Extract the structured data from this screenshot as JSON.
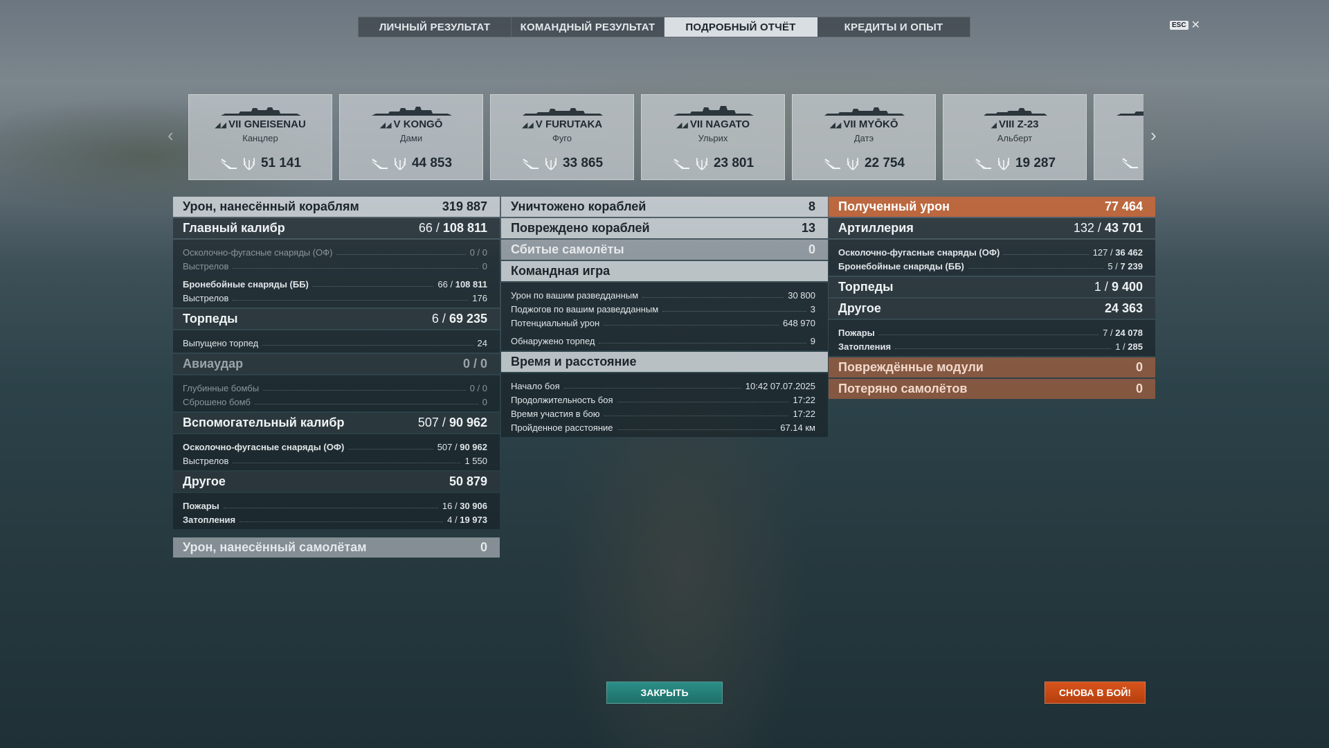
{
  "tabs": [
    {
      "label": "ЛИЧНЫЙ РЕЗУЛЬТАТ",
      "active": false
    },
    {
      "label": "КОМАНДНЫЙ РЕЗУЛЬТАТ",
      "active": false
    },
    {
      "label": "ПОДРОБНЫЙ ОТЧЁТ",
      "active": true
    },
    {
      "label": "КРЕДИТЫ И ОПЫТ",
      "active": false
    }
  ],
  "esc": {
    "key": "ESC",
    "icon": "close-icon",
    "symbol": "✕"
  },
  "ships": [
    {
      "tier": "VII",
      "name": "GNEISENAU",
      "player": "Канцлер",
      "score": "51 141"
    },
    {
      "tier": "V",
      "name": "KONGŌ",
      "player": "Дами",
      "score": "44 853"
    },
    {
      "tier": "V",
      "name": "FURUTAKA",
      "player": "Фуго",
      "score": "33 865"
    },
    {
      "tier": "VII",
      "name": "NAGATO",
      "player": "Ульрих",
      "score": "23 801"
    },
    {
      "tier": "VII",
      "name": "MYŌKŌ",
      "player": "Датэ",
      "score": "22 754"
    },
    {
      "tier": "VIII",
      "name": "Z-23",
      "player": "Альберт",
      "score": "19 287"
    }
  ],
  "left": {
    "damage_ships": {
      "label": "Урон, нанесённый кораблям",
      "value": "319 887"
    },
    "main_battery": {
      "label": "Главный калибр",
      "hits": "66 /",
      "value": "108 811"
    },
    "mb_he": {
      "label": "Осколочно-фугасные снаряды (ОФ)",
      "value": "0 / 0"
    },
    "mb_he_shots": {
      "label": "Выстрелов",
      "value": "0"
    },
    "mb_ap": {
      "label": "Бронебойные снаряды (ББ)",
      "hits": "66 /",
      "value": "108 811"
    },
    "mb_ap_shots": {
      "label": "Выстрелов",
      "value": "176"
    },
    "torpedoes": {
      "label": "Торпеды",
      "hits": "6 /",
      "value": "69 235"
    },
    "torp_launched": {
      "label": "Выпущено торпед",
      "value": "24"
    },
    "airstrike": {
      "label": "Авиаудар",
      "value": "0 / 0"
    },
    "depth_charges": {
      "label": "Глубинные бомбы",
      "value": "0 / 0"
    },
    "bombs_dropped": {
      "label": "Сброшено бомб",
      "value": "0"
    },
    "secondary": {
      "label": "Вспомогательный калибр",
      "hits": "507 /",
      "value": "90 962"
    },
    "sec_he": {
      "label": "Осколочно-фугасные снаряды (ОФ)",
      "hits": "507 /",
      "value": "90 962"
    },
    "sec_shots": {
      "label": "Выстрелов",
      "value": "1 550"
    },
    "other": {
      "label": "Другое",
      "value": "50 879"
    },
    "fires": {
      "label": "Пожары",
      "hits": "16 /",
      "value": "30 906"
    },
    "floods": {
      "label": "Затопления",
      "hits": "4 /",
      "value": "19 973"
    },
    "damage_planes": {
      "label": "Урон, нанесённый самолётам",
      "value": "0"
    }
  },
  "middle": {
    "destroyed": {
      "label": "Уничтожено кораблей",
      "value": "8"
    },
    "damaged": {
      "label": "Повреждено кораблей",
      "value": "13"
    },
    "planes_shot": {
      "label": "Сбитые самолёты",
      "value": "0"
    },
    "teamplay": {
      "label": "Командная игра"
    },
    "spot_damage": {
      "label": "Урон по вашим разведданным",
      "value": "30 800"
    },
    "spot_fires": {
      "label": "Поджогов по вашим разведданным",
      "value": "3"
    },
    "potential": {
      "label": "Потенциальный урон",
      "value": "648 970"
    },
    "torp_spotted": {
      "label": "Обнаружено торпед",
      "value": "9"
    },
    "time": {
      "label": "Время и расстояние"
    },
    "battle_start": {
      "label": "Начало боя",
      "value": "10:42  07.07.2025"
    },
    "battle_duration": {
      "label": "Продолжительность боя",
      "value": "17:22"
    },
    "time_in_battle": {
      "label": "Время участия в бою",
      "value": "17:22"
    },
    "distance": {
      "label": "Пройденное расстояние",
      "value": "67.14 км"
    }
  },
  "right": {
    "received": {
      "label": "Полученный урон",
      "value": "77 464"
    },
    "artillery": {
      "label": "Артиллерия",
      "hits": "132 /",
      "value": "43 701"
    },
    "art_he": {
      "label": "Осколочно-фугасные снаряды (ОФ)",
      "hits": "127 /",
      "value": "36 462"
    },
    "art_ap": {
      "label": "Бронебойные снаряды (ББ)",
      "hits": "5 /",
      "value": "7 239"
    },
    "torpedoes": {
      "label": "Торпеды",
      "hits": "1 /",
      "value": "9 400"
    },
    "other": {
      "label": "Другое",
      "value": "24 363"
    },
    "fires": {
      "label": "Пожары",
      "hits": "7 /",
      "value": "24 078"
    },
    "floods": {
      "label": "Затопления",
      "hits": "1 /",
      "value": "285"
    },
    "modules": {
      "label": "Повреждённые модули",
      "value": "0"
    },
    "planes_lost": {
      "label": "Потеряно самолётов",
      "value": "0"
    }
  },
  "buttons": {
    "close": "ЗАКРЫТЬ",
    "again": "СНОВА В БОЙ!"
  },
  "colors": {
    "accent_orange": "#c4683c",
    "button_teal": "#1f6f6a",
    "button_orange": "#d8541c",
    "active_tab": "#d9dee2"
  }
}
